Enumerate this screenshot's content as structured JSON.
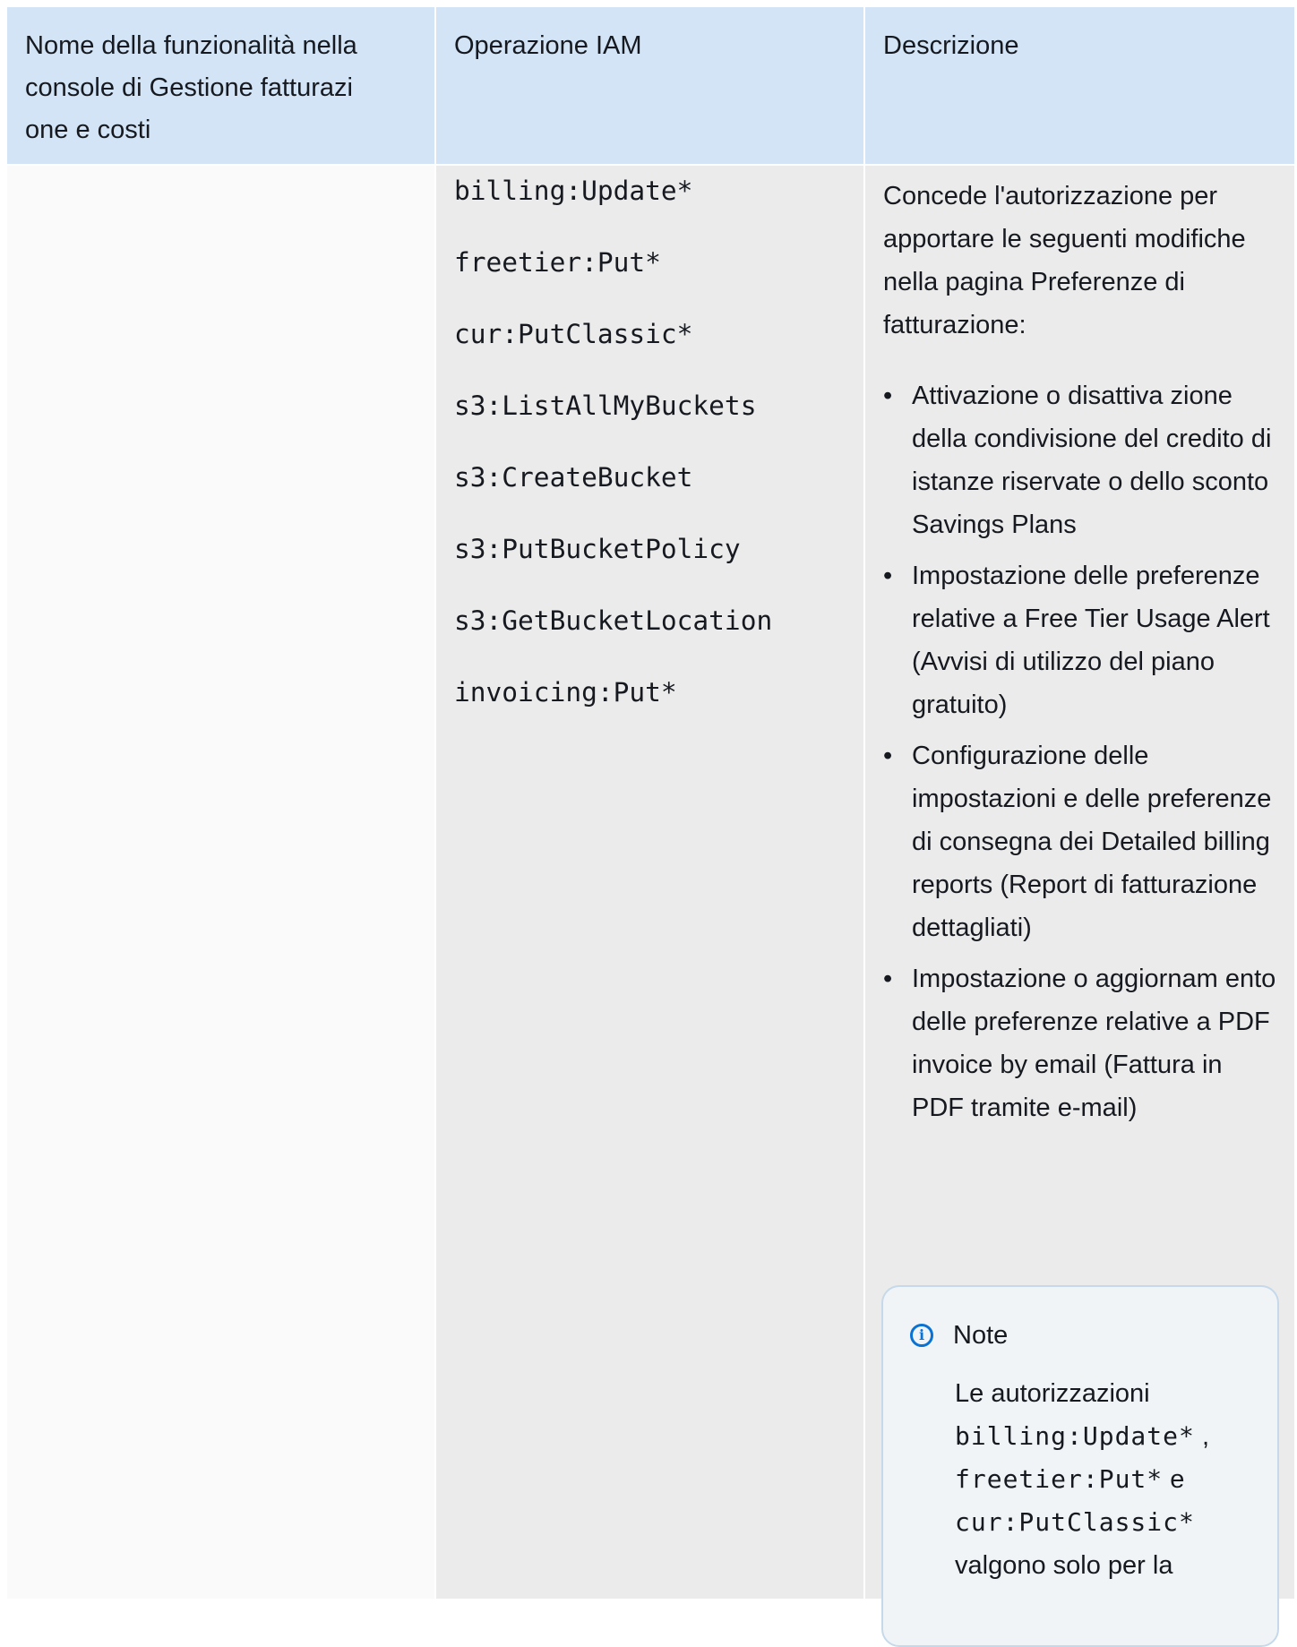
{
  "headers": [
    "Nome della funzionalità nella console di Gestione fatturazi one e costi",
    "Operazione IAM",
    "Descrizione"
  ],
  "row": {
    "feature": "",
    "actions": [
      "billing:Update*",
      "freetier:Put*",
      "cur:PutClassic*",
      "s3:ListAllMyBuckets",
      "s3:CreateBucket",
      "s3:PutBucketPolicy",
      "s3:GetBucketLocation",
      "invoicing:Put*"
    ],
    "description_intro": "Concede l'autorizzazione per apportare le seguenti modifiche nella pagina Preferenze di fatturazione:",
    "description_bullets": [
      "Attivazione o disattiva zione della condivisione del credito di istanze riservate o dello sconto Savings Plans",
      "Impostazione delle preferenze relative a Free Tier Usage Alert (Avvisi di utilizzo del piano gratuito)",
      "Configurazione delle impostazioni e delle preferenze di consegna dei Detailed billing reports (Report di fatturazione dettagliati)",
      "Impostazione o aggiornam ento delle preferenze relative a PDF invoice by email (Fattura in PDF tramite e-mail)"
    ],
    "note": {
      "icon": "info-icon",
      "title": "Note",
      "line1": "Le autorizzazioni",
      "code1": "billing:Update*",
      "sep1": ",",
      "code2": "freetier:Put*",
      "sep2": "e",
      "code3": "cur:PutClassic*",
      "tail": "valgono solo per la"
    }
  }
}
